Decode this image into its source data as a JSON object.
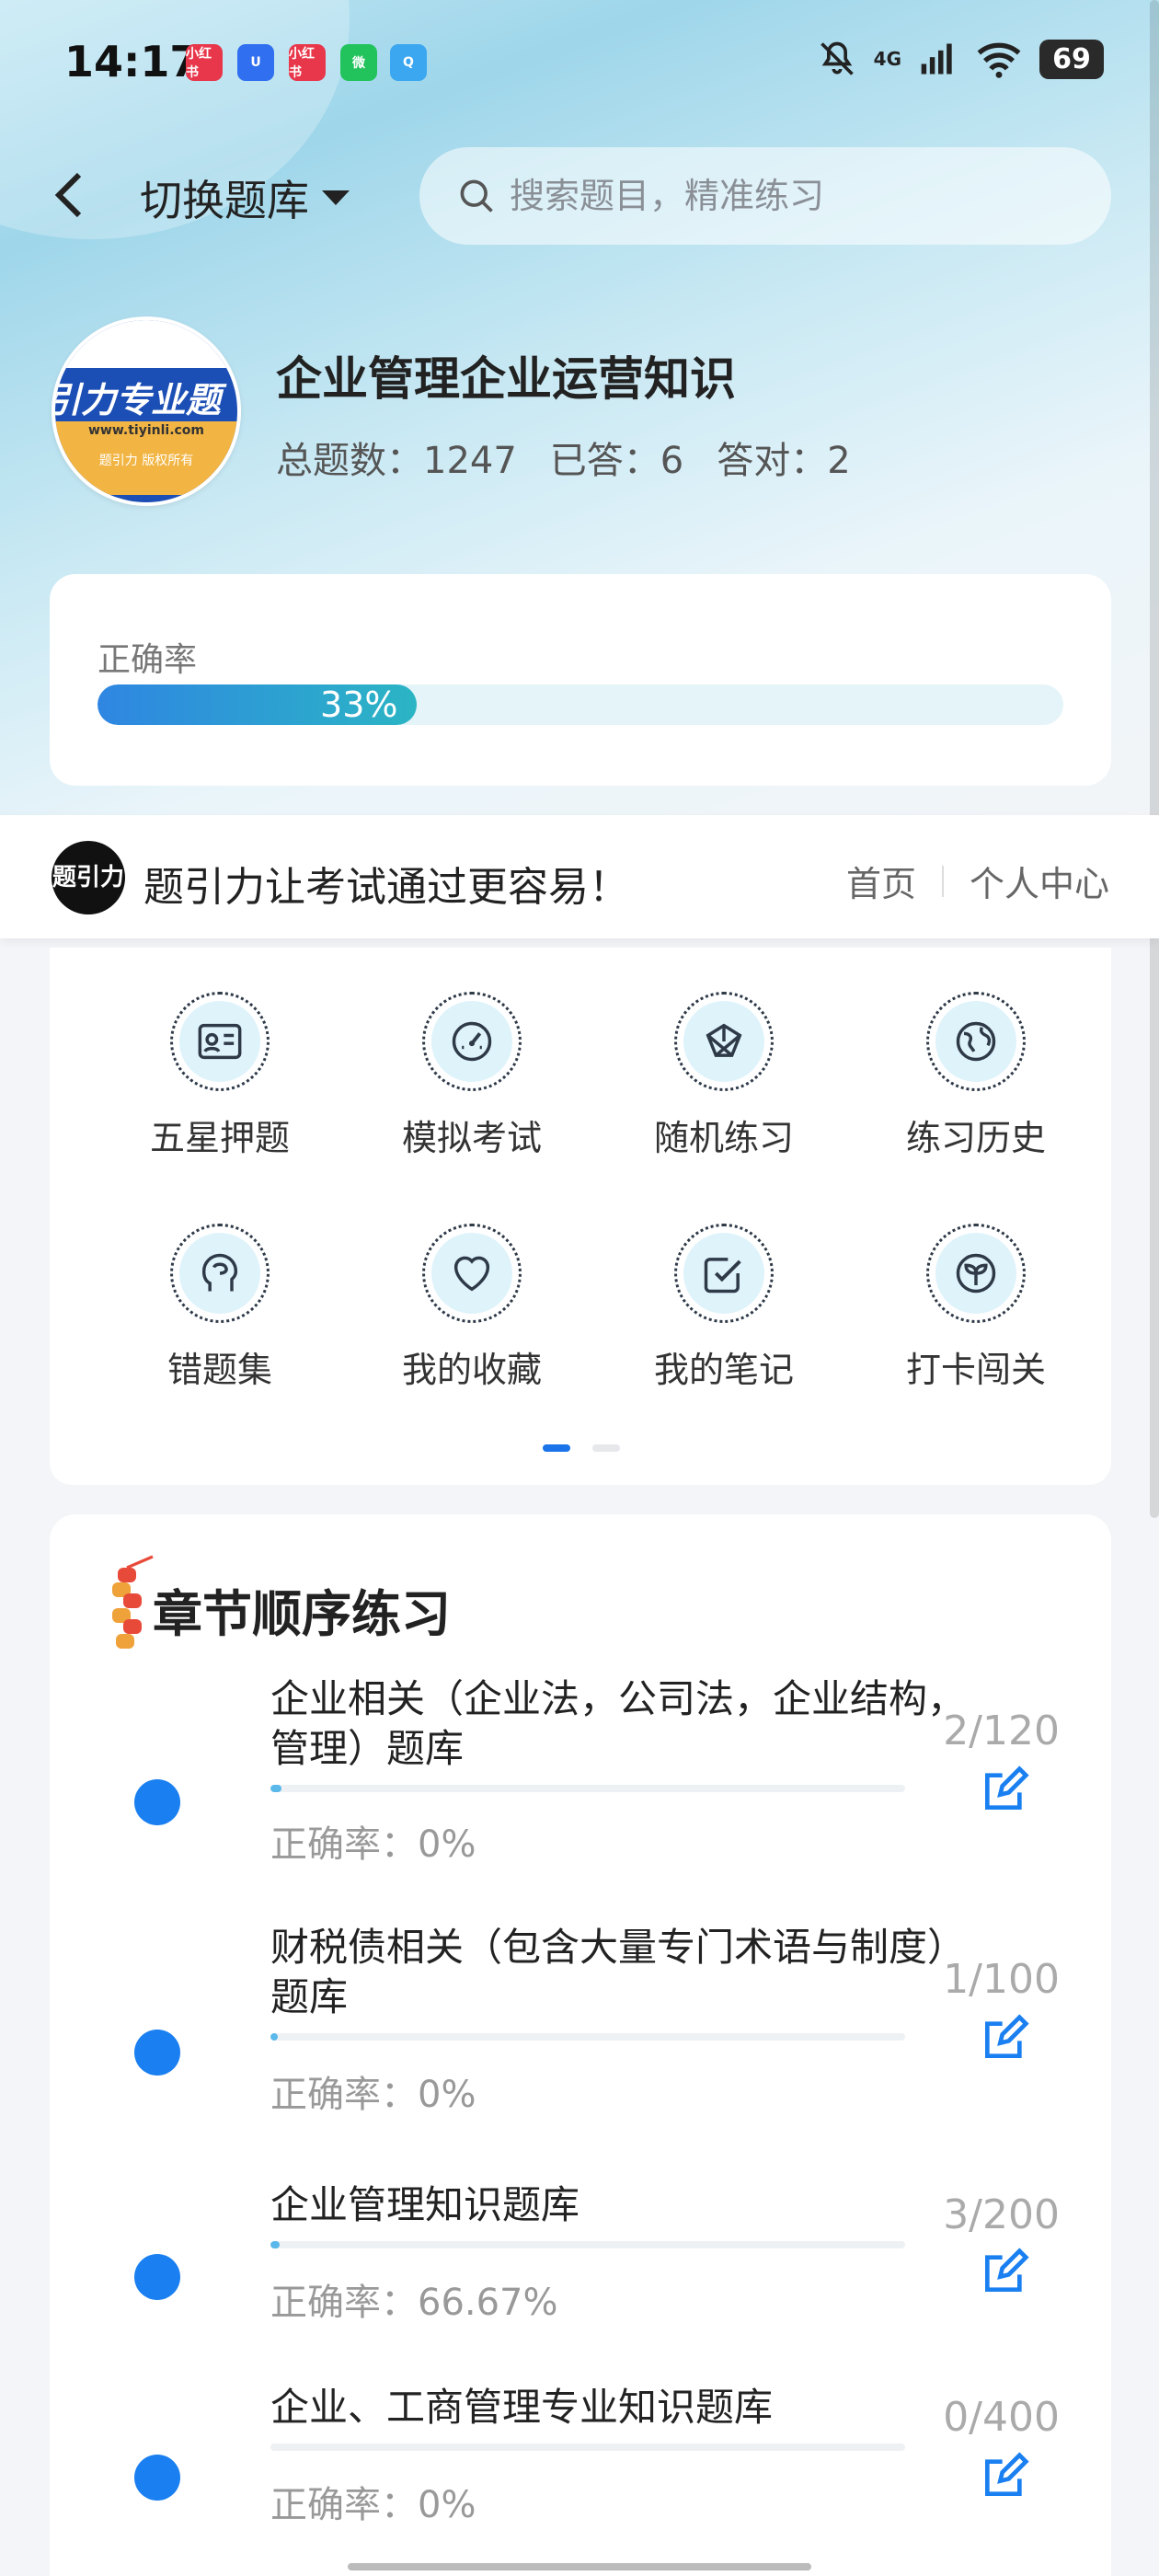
{
  "status_bar": {
    "time": "14:17",
    "network": "4G",
    "battery": "69",
    "notif_apps": [
      {
        "label": "小红书",
        "color": "#e8374b"
      },
      {
        "label": "U",
        "color": "#2f6ff0"
      },
      {
        "label": "小红书",
        "color": "#e8374b"
      },
      {
        "label": "微",
        "color": "#22c35c"
      },
      {
        "label": "Q",
        "color": "#3aa7f0"
      }
    ]
  },
  "header": {
    "switch_label": "切换题库",
    "search_placeholder": "搜索题目，精准练习"
  },
  "bank": {
    "logo_title": "引力专业题",
    "logo_url": "www.tiyinli.com",
    "logo_copyright": "题引力 版权所有",
    "title": "企业管理企业运营知识",
    "total_label": "总题数：1247",
    "answered_label": "已答：6",
    "correct_label": "答对：2"
  },
  "accuracy": {
    "label": "正确率",
    "percent": 33,
    "percent_text": "33%"
  },
  "brand": {
    "logo_text": "题引力",
    "slogan": "题引力让考试通过更容易！",
    "nav_home": "首页",
    "nav_profile": "个人中心"
  },
  "grid_menu": {
    "items": [
      {
        "label": "五星押题",
        "icon": "id-card-icon"
      },
      {
        "label": "模拟考试",
        "icon": "gauge-icon"
      },
      {
        "label": "随机练习",
        "icon": "network-icon"
      },
      {
        "label": "练习历史",
        "icon": "globe-icon"
      },
      {
        "label": "错题集",
        "icon": "head-icon"
      },
      {
        "label": "我的收藏",
        "icon": "heart-icon"
      },
      {
        "label": "我的笔记",
        "icon": "checkbox-icon"
      },
      {
        "label": "打卡闯关",
        "icon": "sprout-icon"
      }
    ],
    "page": 1,
    "pages": 2
  },
  "chapters": {
    "title": "章节顺序练习",
    "rows": [
      {
        "title": "企业相关（企业法，公司法，企业结构，管理）题库",
        "progress": 0.017,
        "accuracy": "正确率：0%",
        "count": "2/120"
      },
      {
        "title": "财税债相关（包含大量专门术语与制度）题库",
        "progress": 0.01,
        "accuracy": "正确率：0%",
        "count": "1/100"
      },
      {
        "title": "企业管理知识题库",
        "progress": 0.015,
        "accuracy": "正确率：66.67%",
        "count": "3/200"
      },
      {
        "title": "企业、工商管理专业知识题库",
        "progress": 0,
        "accuracy": "正确率：0%",
        "count": "0/400"
      }
    ]
  },
  "colors": {
    "accent": "#1a7ff0",
    "progress_start": "#2f86e2",
    "progress_end": "#2bb5c4"
  }
}
